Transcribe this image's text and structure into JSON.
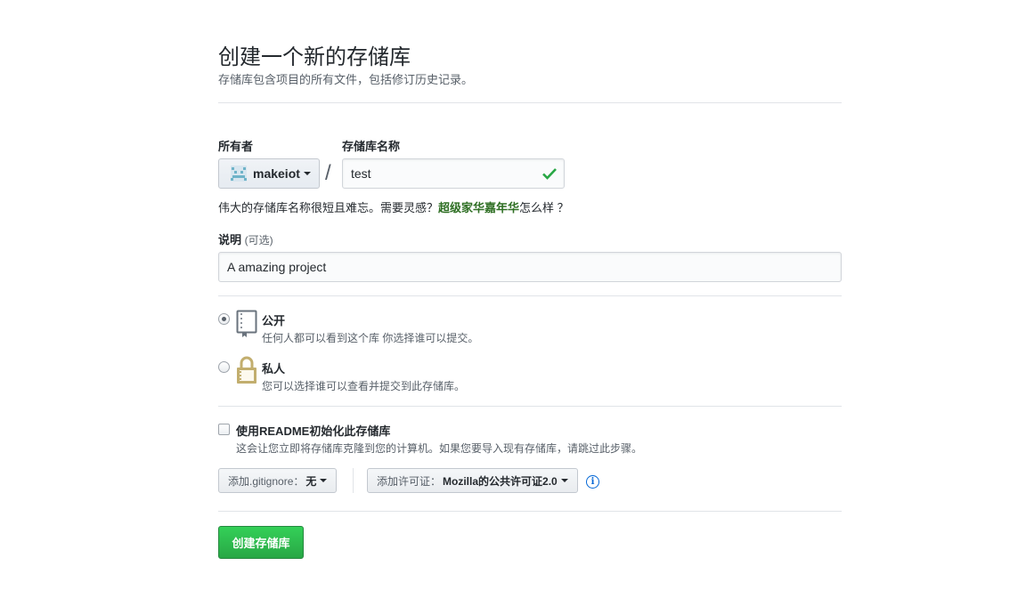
{
  "header": {
    "title": "创建一个新的存储库",
    "subtitle": "存储库包含项目的所有文件，包括修订历史记录。"
  },
  "owner": {
    "label": "所有者",
    "value": "makeiot"
  },
  "repo": {
    "label": "存储库名称",
    "value": "test",
    "separator": "/"
  },
  "hint": {
    "prefix": "伟大的存储库名称很短且难忘。需要灵感？",
    "suggestion": "超级家华嘉年华",
    "suffix": "怎么样 ？"
  },
  "description": {
    "label": "说明",
    "optional": "(可选)",
    "value": "A amazing project"
  },
  "visibility": {
    "public": {
      "title": "公开",
      "desc": "任何人都可以看到这个库 你选择谁可以提交。"
    },
    "private": {
      "title": "私人",
      "desc": "您可以选择谁可以查看并提交到此存储库。"
    }
  },
  "readme": {
    "title": "使用README初始化此存储库",
    "desc": "这会让您立即将存储库克隆到您的计算机。如果您要导入现有存储库，请跳过此步骤。"
  },
  "gitignore": {
    "label": "添加.gitignore：",
    "value": "无"
  },
  "license": {
    "label": "添加许可证：",
    "value": "Mozilla的公共许可证2.0"
  },
  "info_icon": "i",
  "create_button": "创建存储库",
  "colors": {
    "accent_green": "#28a745",
    "suggest_green": "#2f6f24",
    "info_blue": "#0366d6"
  }
}
